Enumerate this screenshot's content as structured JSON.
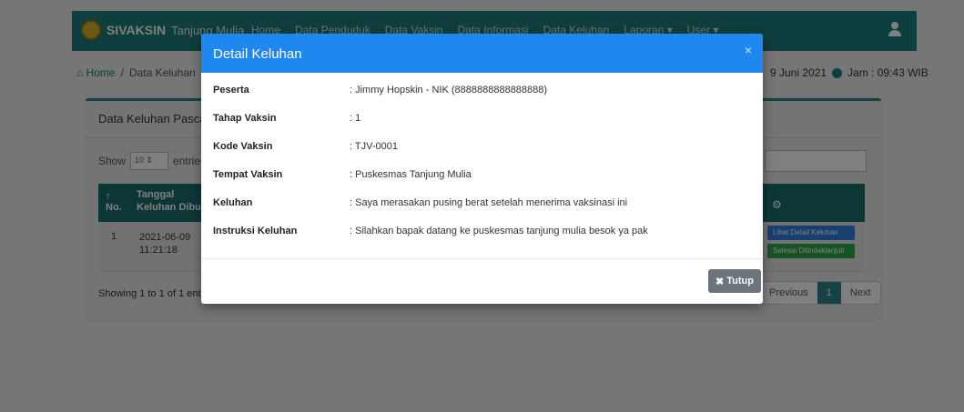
{
  "navbar": {
    "brand": "SIVAKSIN",
    "brand_sub": "Tanjung Mulia",
    "links": [
      "Home",
      "Data Penduduk",
      "Data Vaksin",
      "Data Informasi",
      "Data Keluhan",
      "Laporan ▾",
      "User ▾"
    ]
  },
  "breadcrumb": {
    "home": "Home",
    "separator": "/",
    "current": "Data Keluhan"
  },
  "datebar": {
    "date": "9 Juni 2021",
    "time": "Jam : 09:43 WIB"
  },
  "card": {
    "title": "Data Keluhan Pasca Vaksin",
    "show_label": "Show",
    "entries_value": "10",
    "entries_label": "entries",
    "columns": {
      "no": "No.",
      "date_line1": "Tanggal",
      "date_line2": "Keluhan Dibuat"
    },
    "rows": [
      {
        "no": "1",
        "date": "2021-06-09",
        "time": "11:21:18",
        "detail_label": "Lihat Detail Keluhan",
        "done_label": "Selesai Ditindaklanjuti"
      }
    ],
    "showing_text": "Showing 1 to 1 of 1 entries",
    "pager": {
      "previous": "Previous",
      "current": "1",
      "next": "Next"
    }
  },
  "modal": {
    "title": "Detail Keluhan",
    "close_symbol": "×",
    "fields": [
      {
        "label": "Peserta",
        "value": ": Jimmy Hopskin - NIK (8888888888888888)"
      },
      {
        "label": "Tahap Vaksin",
        "value": ": 1"
      },
      {
        "label": "Kode Vaksin",
        "value": ": TJV-0001"
      },
      {
        "label": "Tempat Vaksin",
        "value": ": Puskesmas Tanjung Mulia"
      },
      {
        "label": "Keluhan",
        "value": ": Saya merasakan pusing berat setelah menerima vaksinasi ini"
      },
      {
        "label": "Instruksi Keluhan",
        "value": ": Silahkan bapak datang ke puskesmas tanjung mulia besok ya pak"
      }
    ],
    "close_button_icon": "✖",
    "close_button_label": "Tutup"
  },
  "icons": {
    "home": "home-icon",
    "clock": "clock-icon",
    "gear": "gear-icon",
    "user": "user-icon"
  },
  "colors": {
    "navbar": "#1f7c7c",
    "modal_header": "#1e87f0",
    "close_button": "#6c757d"
  }
}
